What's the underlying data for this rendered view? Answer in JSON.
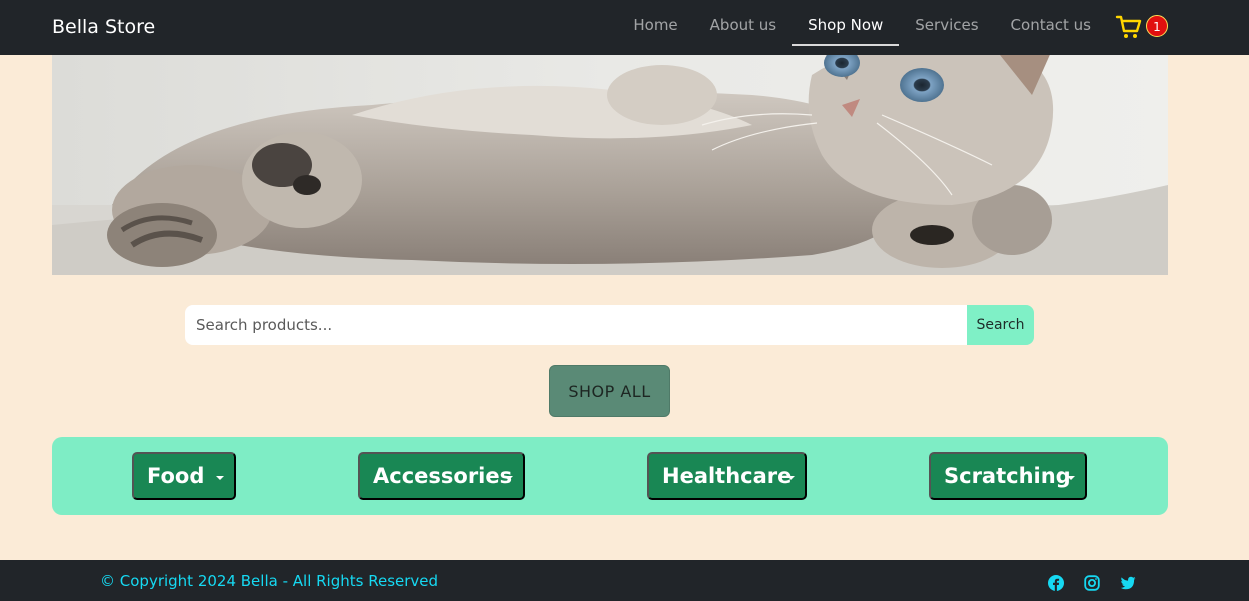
{
  "brand": {
    "name": "Bella Store"
  },
  "nav": {
    "links": [
      {
        "label": "Home"
      },
      {
        "label": "About us"
      },
      {
        "label": "Shop Now"
      },
      {
        "label": "Services"
      },
      {
        "label": "Contact us"
      }
    ],
    "active": "Shop Now",
    "cart_count": "1",
    "cart_icon": "cart-icon",
    "colors": {
      "cart": "#ffd600",
      "badge": "#e10f0f"
    }
  },
  "search": {
    "placeholder": "Search products...",
    "button_label": "Search"
  },
  "shop_all": {
    "label": "SHOP ALL"
  },
  "categories": [
    {
      "label": "Food"
    },
    {
      "label": "Accessories"
    },
    {
      "label": "Healthcare"
    },
    {
      "label": "Scratching"
    }
  ],
  "footer": {
    "copyright": "© Copyright 2024 Bella - All Rights Reserved",
    "social_icons": [
      "facebook-icon",
      "instagram-icon",
      "twitter-icon"
    ],
    "colors": {
      "text": "#16d9f2"
    }
  },
  "colors": {
    "background": "#fbebd7",
    "navbar": "#212529",
    "accent_mint": "#7eedc5",
    "category_green": "#198754"
  }
}
